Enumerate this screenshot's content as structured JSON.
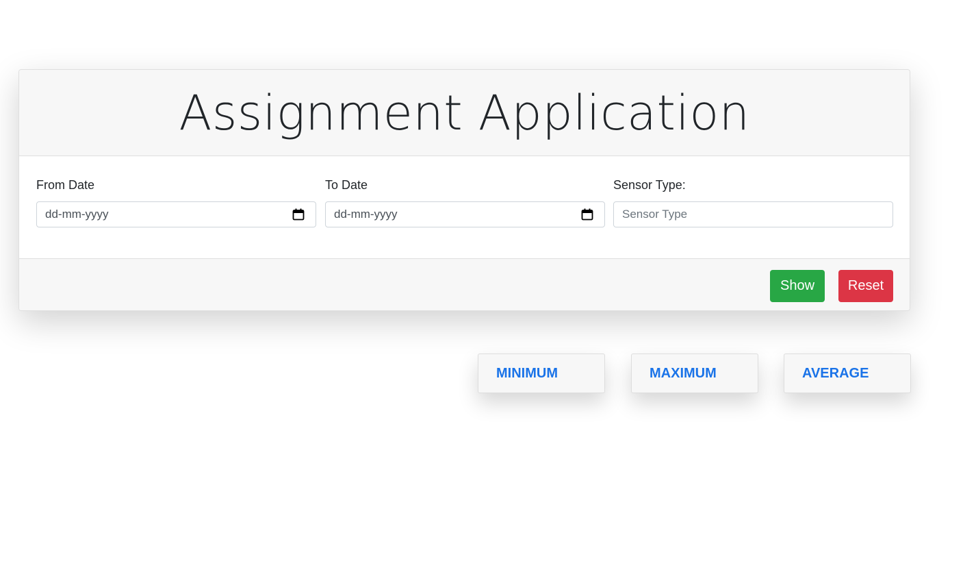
{
  "header": {
    "title": "Assignment Application"
  },
  "form": {
    "from_date": {
      "label": "From Date",
      "placeholder": "dd-mm-yyyy"
    },
    "to_date": {
      "label": "To Date",
      "placeholder": "dd-mm-yyyy"
    },
    "sensor_type": {
      "label": "Sensor Type:",
      "placeholder": "Sensor Type"
    }
  },
  "footer": {
    "show_label": "Show",
    "reset_label": "Reset"
  },
  "stats": {
    "minimum_label": "MINIMUM",
    "maximum_label": "MAXIMUM",
    "average_label": "AVERAGE"
  },
  "icons": {
    "from_date_icon": "calendar-icon",
    "to_date_icon": "calendar-icon"
  },
  "colors": {
    "show_button": "#28a745",
    "reset_button": "#dc3545",
    "stat_text": "#1a73e8"
  }
}
